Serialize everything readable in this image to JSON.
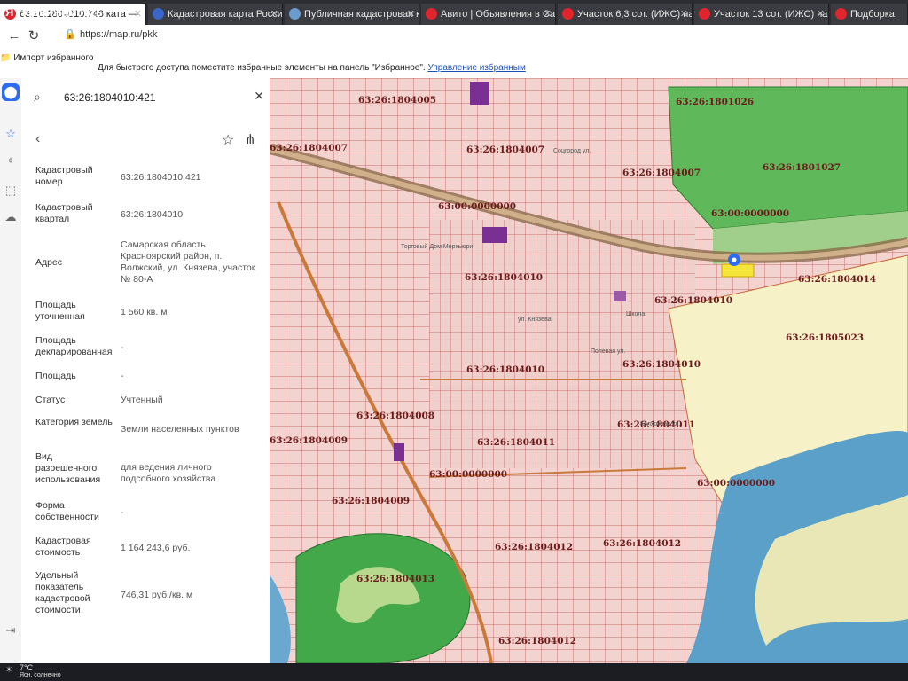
{
  "browser": {
    "tabs": [
      {
        "title": "63:26:1804010:746 ката —",
        "color": "#e0262c"
      },
      {
        "title": "Кадастровая карта Росси",
        "color": "#3a66c9"
      },
      {
        "title": "Публичная кадастровая к",
        "color": "#6b9ccd"
      },
      {
        "title": "Авито | Объявления в Са",
        "color": "#e0262c"
      },
      {
        "title": "Участок 6,3 сот. (ИЖС) на",
        "color": "#e0262c"
      },
      {
        "title": "Участок 13 сот. (ИЖС) на",
        "color": "#e0262c"
      },
      {
        "title": "Подборка",
        "color": "#e0262c"
      }
    ],
    "url": "https://map.ru/pkk",
    "favorites_import": "Импорт избранного",
    "favorites_hint": "Для быстрого доступа поместите избранные элементы на панель \"Избранное\".",
    "favorites_manage": "Управление избранным"
  },
  "watermark": "Недвижимость",
  "panel": {
    "search_value": "63:26:1804010:421",
    "fields": [
      {
        "label": "Кадастровый номер",
        "value": "63:26:1804010:421"
      },
      {
        "label": "Кадастровый квартал",
        "value": "63:26:1804010"
      },
      {
        "label": "Адрес",
        "value": "Самарская область, Красноярский район, п. Волжский, ул. Князева, участок № 80-А"
      },
      {
        "label": "Площадь уточненная",
        "value": "1 560 кв. м"
      },
      {
        "label": "Площадь декларированная",
        "value": "-"
      },
      {
        "label": "Площадь",
        "value": "-"
      },
      {
        "label": "Статус",
        "value": "Учтенный"
      },
      {
        "label": "Категория земель",
        "value": "Земли населенных пунктов"
      },
      {
        "label": "Вид разрешенного использования",
        "value": "для ведения личного подсобного хозяйства"
      },
      {
        "label": "Форма собственности",
        "value": "-"
      },
      {
        "label": "Кадастровая стоимость",
        "value": "1 164 243,6 руб."
      },
      {
        "label": "Удельный показатель кадастровой стоимости",
        "value": "746,31 руб./кв. м"
      }
    ]
  },
  "map": {
    "labels": [
      "63:26:1804005",
      "63:26:1804007",
      "63:26:1804007",
      "63:26:1801026",
      "63:26:1801027",
      "63:26:1804007",
      "63:00:0000000",
      "63:00:0000000",
      "63:26:1804010",
      "63:26:1804014",
      "63:26:1804010",
      "63:26:1805023",
      "63:26:1804010",
      "63:26:1804010",
      "63:26:1804008",
      "63:26:1804011",
      "63:26:1804011",
      "63:26:1804009",
      "63:00:0000000",
      "63:26:1804009",
      "63:00:0000000",
      "63:26:1804012",
      "63:26:1804012",
      "63:26:1804013",
      "63:26:1804012"
    ],
    "places": [
      "Торговый Дом Меркьюри",
      "Школа",
      "Полевая ул.",
      "ул. Князева",
      "Соцгород ул.",
      "Колхозная ул."
    ]
  },
  "taskbar": {
    "temp": "7°C",
    "weather": "Ясн. солнечно"
  }
}
